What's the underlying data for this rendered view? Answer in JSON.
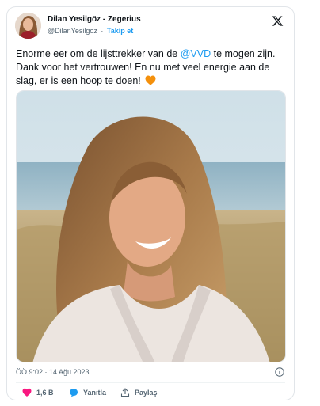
{
  "author": {
    "name": "Dilan Yesilgöz - Zegerius",
    "handle": "@DilanYesilgoz",
    "separator": "·",
    "follow_label": "Takip et"
  },
  "tweet": {
    "text_part1": "Enorme eer om de lijsttrekker van de ",
    "mention": "@VVD",
    "text_part2": " te mogen zijn. Dank voor het vertrouwen! En nu met veel energie aan de slag, er is een hoop te doen!",
    "emoji": "orange-heart-icon"
  },
  "photo": {
    "description_icon": "portrait-photo"
  },
  "timestamp": "ÖÖ 9:02 · 14 Ağu 2023",
  "actions": {
    "like_count": "1,6 B",
    "reply_label": "Yanıtla",
    "share_label": "Paylaş"
  },
  "colors": {
    "accent": "#1d9bf0",
    "like": "#f91880",
    "text": "#0f1419",
    "muted": "#536471"
  }
}
